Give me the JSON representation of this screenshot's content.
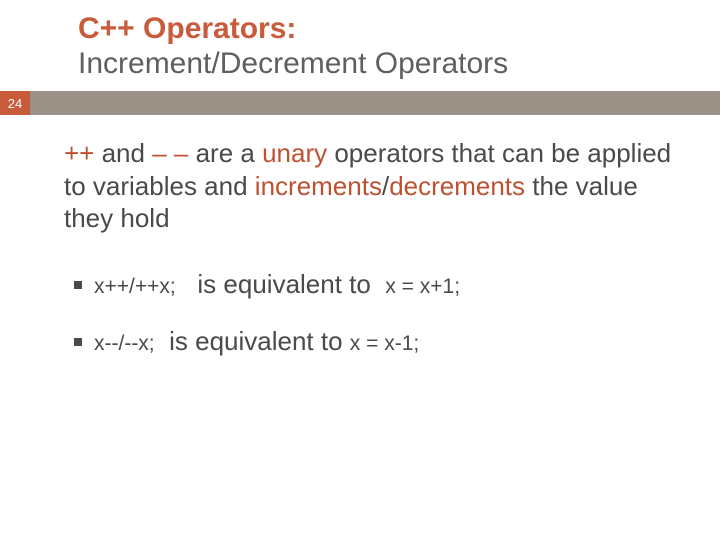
{
  "slide": {
    "page_number": "24",
    "title_line1": "C++ Operators:",
    "title_line2": "Increment/Decrement Operators",
    "main_para": {
      "seg1": "++",
      "seg2": " and ",
      "seg3": "– –",
      "seg4": " are a ",
      "seg5": "unary",
      "seg6": " operators that can be applied to variables and ",
      "seg7": "increments",
      "seg8": "/",
      "seg9": "decrements",
      "seg10": "  the value they hold"
    },
    "bullets": [
      {
        "code": "x++/++x;",
        "mid": "is equivalent to",
        "eq": "x = x+1;"
      },
      {
        "code": "x--/--x;",
        "mid": "is equivalent to",
        "eq": "x = x-1;"
      }
    ]
  }
}
